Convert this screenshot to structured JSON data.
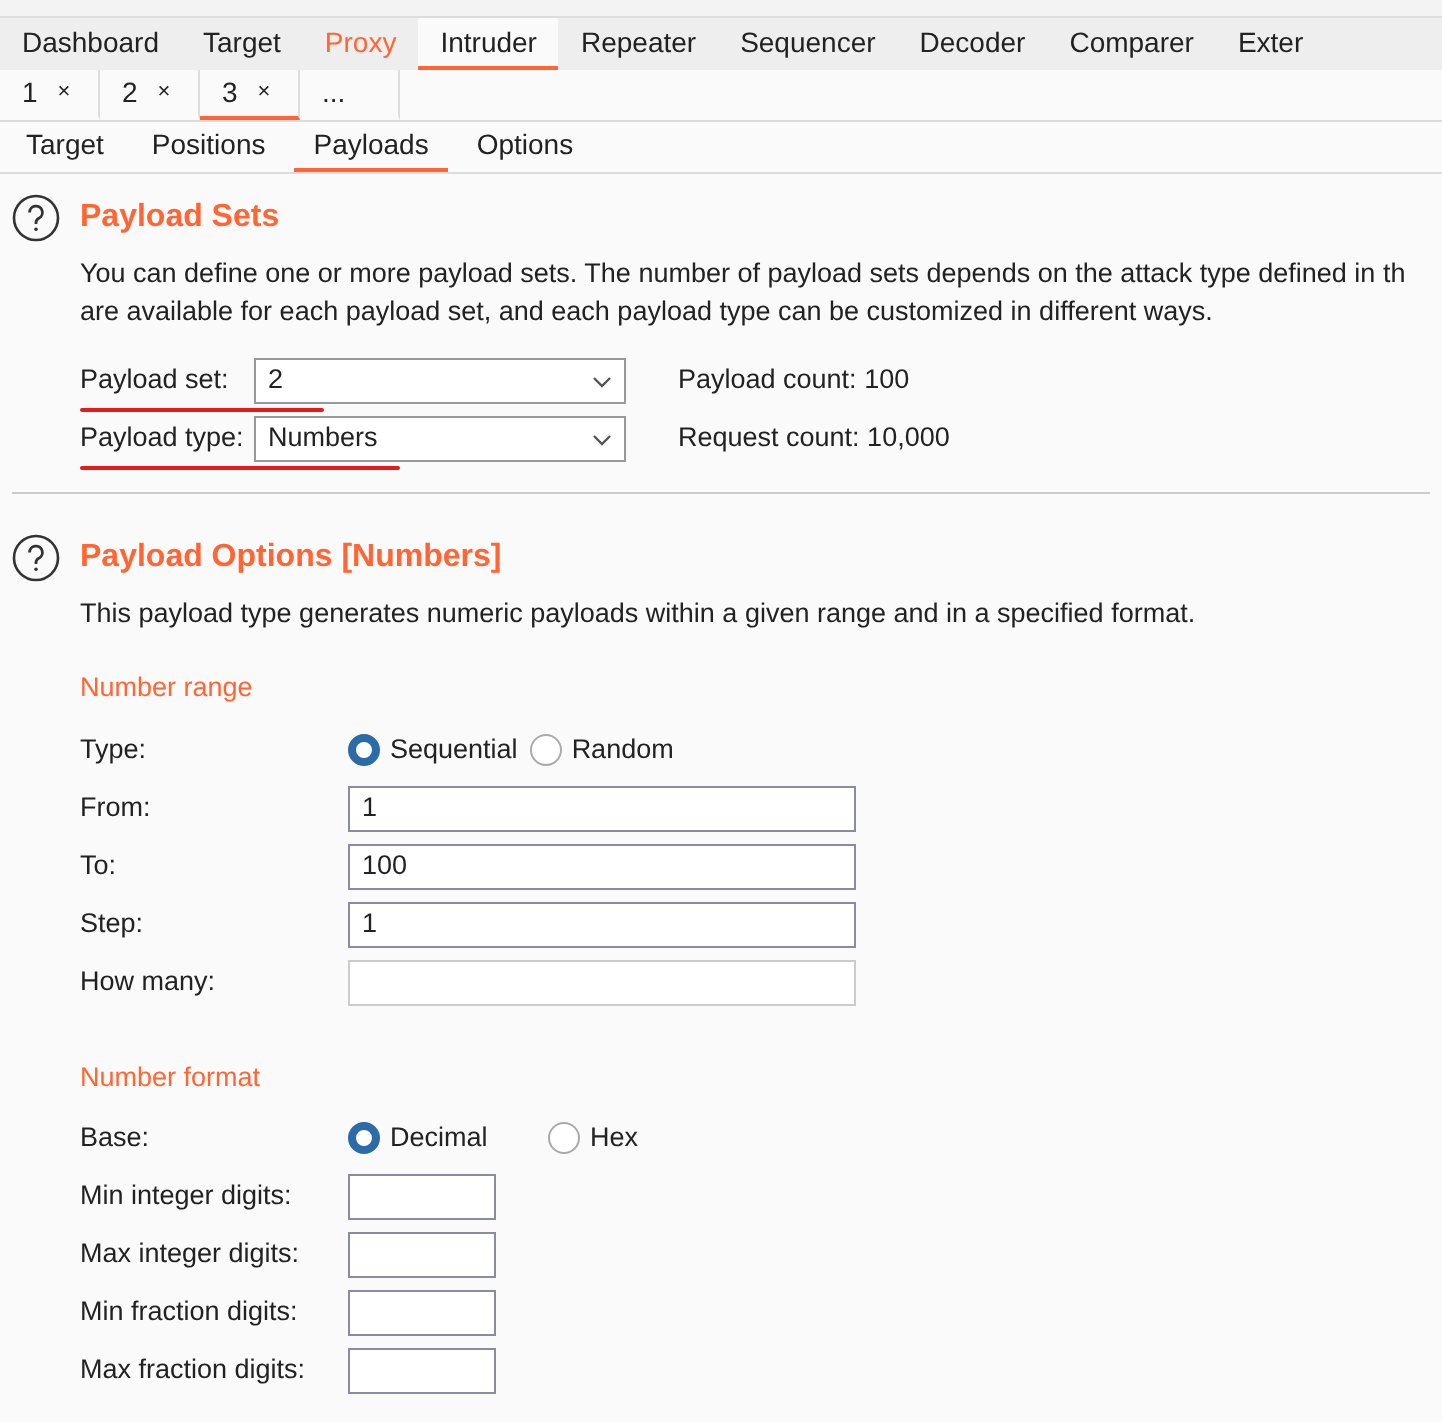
{
  "main_tabs": [
    {
      "label": "Dashboard",
      "selected": false,
      "highlighted": false
    },
    {
      "label": "Target",
      "selected": false,
      "highlighted": false
    },
    {
      "label": "Proxy",
      "selected": false,
      "highlighted": true
    },
    {
      "label": "Intruder",
      "selected": true,
      "highlighted": false
    },
    {
      "label": "Repeater",
      "selected": false,
      "highlighted": false
    },
    {
      "label": "Sequencer",
      "selected": false,
      "highlighted": false
    },
    {
      "label": "Decoder",
      "selected": false,
      "highlighted": false
    },
    {
      "label": "Comparer",
      "selected": false,
      "highlighted": false
    },
    {
      "label": "Exter",
      "selected": false,
      "highlighted": false
    }
  ],
  "attack_tabs": [
    {
      "label": "1",
      "close": "×",
      "selected": false
    },
    {
      "label": "2",
      "close": "×",
      "selected": false
    },
    {
      "label": "3",
      "close": "×",
      "selected": true
    },
    {
      "label": "...",
      "selected": false
    }
  ],
  "sub_tabs": [
    {
      "label": "Target",
      "selected": false
    },
    {
      "label": "Positions",
      "selected": false
    },
    {
      "label": "Payloads",
      "selected": true
    },
    {
      "label": "Options",
      "selected": false
    }
  ],
  "payload_sets": {
    "title": "Payload Sets",
    "description_lines": [
      "You can define one or more payload sets. The number of payload sets depends on the attack type defined in th",
      "are available for each payload set, and each payload type can be customized in different ways."
    ],
    "rows": [
      {
        "label": "Payload set:",
        "value": "2",
        "underlined": true,
        "info": "Payload count: 100"
      },
      {
        "label": "Payload type:",
        "value": "Numbers",
        "underlined": true,
        "info": "Request count: 10,000"
      }
    ]
  },
  "payload_options": {
    "title": "Payload Options [Numbers]",
    "description": "This payload type generates numeric payloads within a given range and in a specified format.",
    "sections": [
      {
        "heading": "Number range",
        "rows": [
          {
            "kind": "radio",
            "label": "Type:",
            "options": [
              {
                "label": "Sequential",
                "selected": true
              },
              {
                "label": "Random",
                "selected": false
              }
            ]
          },
          {
            "kind": "text",
            "label": "From:",
            "value": "1",
            "disabled": false
          },
          {
            "kind": "text",
            "label": "To:",
            "value": "100",
            "disabled": false
          },
          {
            "kind": "text",
            "label": "Step:",
            "value": "1",
            "disabled": false
          },
          {
            "kind": "text",
            "label": "How many:",
            "disabled": true
          }
        ]
      },
      {
        "heading": "Number format",
        "rows": [
          {
            "kind": "radio",
            "label": "Base:",
            "options": [
              {
                "label": "Decimal",
                "selected": true
              },
              {
                "label": "Hex",
                "selected": false
              }
            ]
          },
          {
            "kind": "small",
            "label": "Min integer digits:"
          },
          {
            "kind": "small",
            "label": "Max integer digits:"
          },
          {
            "kind": "small",
            "label": "Min fraction digits:"
          },
          {
            "kind": "small",
            "label": "Max fraction digits:"
          }
        ]
      }
    ]
  }
}
